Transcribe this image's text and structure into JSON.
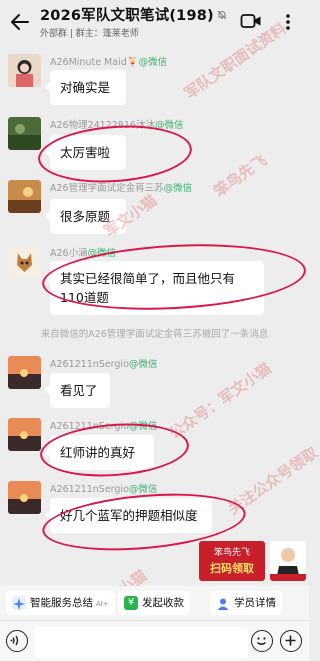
{
  "header": {
    "title": "2026军队文职笔试",
    "count": "(198)",
    "subtitle": "外部群 | 群主：蓬莱老师"
  },
  "messages": [
    {
      "sender": "A26Minute Maid🍹",
      "source": "@微信",
      "text": "对确实是"
    },
    {
      "sender": "A26物理24122816沐沐",
      "source": "@微信",
      "text": "太厉害啦"
    },
    {
      "sender": "A26管理学面试定金蒋三苏",
      "source": "@微信",
      "text": "很多原题"
    },
    {
      "sender": "A26小涵",
      "source": "@微信",
      "text_line1": "其实已经很简单了，而且他只有",
      "text_line2": "110道题"
    },
    {
      "sender": "A261211nSergio",
      "source": "@微信",
      "text": "看见了"
    },
    {
      "sender": "A261211nSergio",
      "source": "@微信",
      "text": "红师讲的真好"
    },
    {
      "sender": "A261211nSergio",
      "source": "@微信",
      "text": "好几个蓝军的押题相似度"
    }
  ],
  "system_notice": "来自微信的A26管理学面试定金蒋三苏撤回了一条消息",
  "watermarks": {
    "red_1": "军队文职面试资料",
    "red_2": "笨鸟先飞",
    "red_3": "军文小猫",
    "red_4": "公众号：军文小猫",
    "red_5": "军文小猫",
    "red_6": "关注公众号领取"
  },
  "ad": {
    "line1": "笨鸟先飞",
    "line2": "扫码领取"
  },
  "quick_actions": [
    {
      "label": "智能服务总结",
      "badge": "AI+",
      "icon": "sparkle-icon",
      "color": "#4a7cf7"
    },
    {
      "label": "发起收款",
      "icon": "yen-icon",
      "color": "#2bb24c"
    },
    {
      "label": "学员详情",
      "icon": "person-icon",
      "color": "#4a7cf7"
    }
  ],
  "colors": {
    "wechat_green": "#3cb371",
    "annotation_red": "#d8184a",
    "background": "#ededed"
  }
}
